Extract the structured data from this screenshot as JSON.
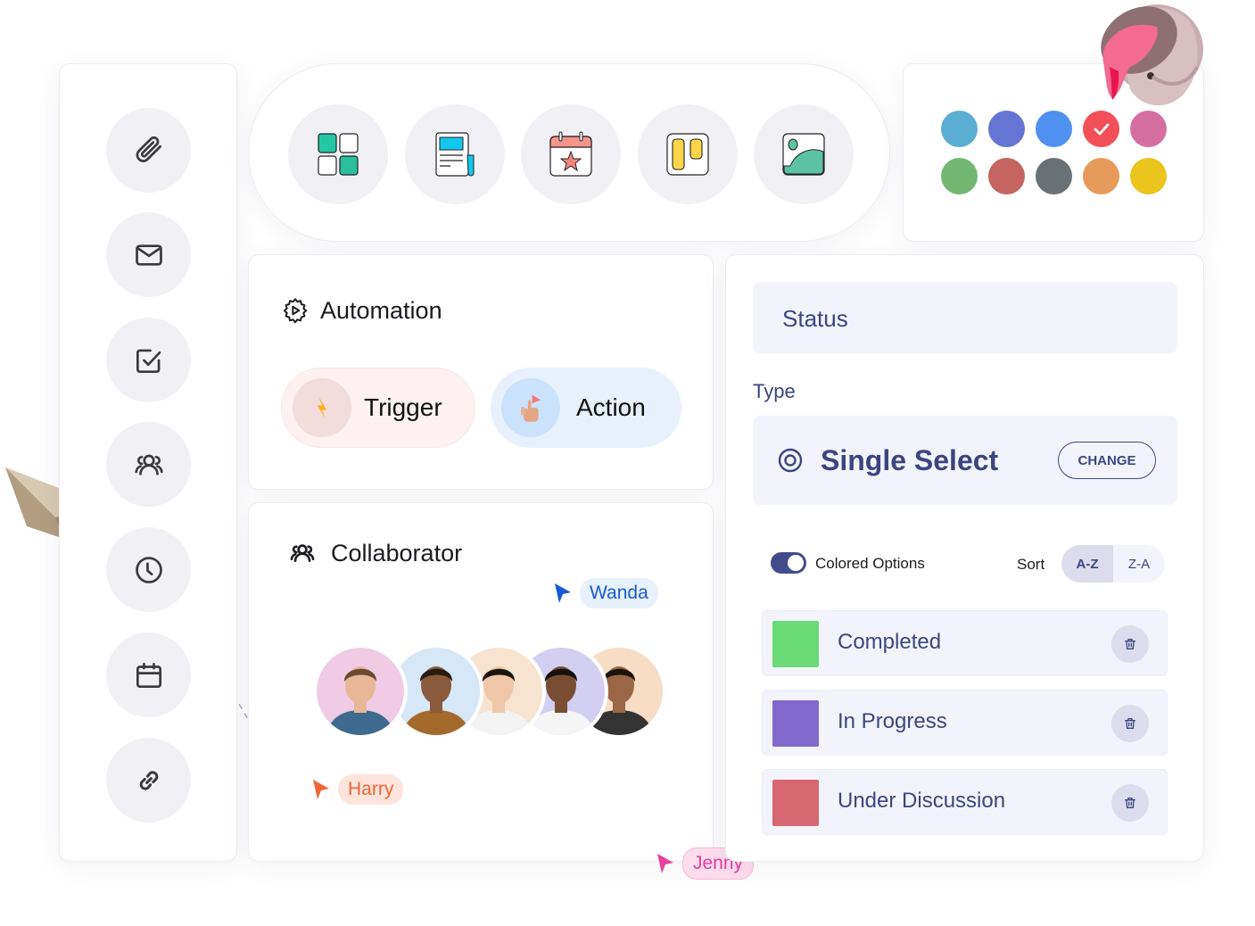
{
  "sidebar": {
    "items": [
      {
        "name": "attachment",
        "icon": "paperclip-icon"
      },
      {
        "name": "email",
        "icon": "mail-icon"
      },
      {
        "name": "tasks",
        "icon": "checkbox-icon"
      },
      {
        "name": "users",
        "icon": "users-icon"
      },
      {
        "name": "history",
        "icon": "clock-icon"
      },
      {
        "name": "calendar",
        "icon": "calendar-icon"
      },
      {
        "name": "link",
        "icon": "link-icon"
      }
    ]
  },
  "apps": {
    "items": [
      {
        "name": "dashboard",
        "icon": "grid-widgets-icon"
      },
      {
        "name": "document",
        "icon": "newsletter-icon"
      },
      {
        "name": "event",
        "icon": "calendar-star-icon"
      },
      {
        "name": "kanban",
        "icon": "kanban-board-icon"
      },
      {
        "name": "gallery",
        "icon": "image-gallery-icon"
      }
    ]
  },
  "color_panel": {
    "selected_index": 3,
    "swatches": [
      "#5aaed4",
      "#6674d4",
      "#5090f0",
      "#f25058",
      "#d66fa1",
      "#72b872",
      "#c66462",
      "#6a7176",
      "#e79b5b",
      "#ebc41d"
    ]
  },
  "automation": {
    "title": "Automation",
    "trigger_label": "Trigger",
    "action_label": "Action"
  },
  "collaborator": {
    "title": "Collaborator",
    "avatar_backgrounds": [
      "#f0cbe6",
      "#d6e7f7",
      "#f7e3d0",
      "#d2cff0",
      "#f7dcc6"
    ],
    "cursors": [
      {
        "name": "Wanda",
        "color": "#1859d6",
        "bg": "#e6f1fd"
      },
      {
        "name": "Harry",
        "color": "#f06537",
        "bg": "#fde5dc"
      },
      {
        "name": "Jenny",
        "color": "#e83e9c",
        "bg": "#fdddec"
      }
    ]
  },
  "field": {
    "name_value": "Status",
    "type_label": "Type",
    "type_value": "Single Select",
    "change_button": "CHANGE",
    "colored_options_label": "Colored Options",
    "colored_options_on": true,
    "sort_label": "Sort",
    "sort_options": [
      "A-Z",
      "Z-A"
    ],
    "sort_selected": "A-Z",
    "options": [
      {
        "label": "Completed",
        "color": "#6ada76"
      },
      {
        "label": "In Progress",
        "color": "#8168cc"
      },
      {
        "label": "Under Discussion",
        "color": "#d76872"
      }
    ]
  }
}
